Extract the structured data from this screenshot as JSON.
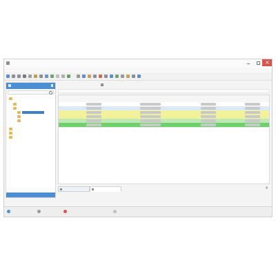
{
  "window": {
    "title": "",
    "controls": {
      "minimize": "",
      "maximize": "",
      "close": ""
    }
  },
  "menu": [
    {
      "label": ""
    },
    {
      "label": ""
    },
    {
      "label": ""
    },
    {
      "label": ""
    },
    {
      "label": ""
    },
    {
      "label": ""
    },
    {
      "label": ""
    }
  ],
  "toolbar": [
    {
      "icon": "save-icon",
      "color": "#5a8fd1"
    },
    {
      "icon": "undo-icon",
      "color": "#8a8f99"
    },
    {
      "icon": "redo-icon",
      "color": "#8a8f99"
    },
    {
      "icon": "print-icon",
      "color": "#7a7a7a"
    },
    {
      "icon": "copy-icon",
      "color": "#a0a0a0"
    },
    {
      "icon": "paste-icon",
      "color": "#c2a04a"
    },
    {
      "icon": "cut-icon",
      "color": "#8a8f99"
    },
    {
      "icon": "find-icon",
      "color": "#6e93c9"
    },
    {
      "icon": "refresh-icon",
      "color": "#6aa96e"
    },
    {
      "icon": "filter-icon",
      "color": "#c0c0c0"
    },
    {
      "icon": "sort-icon",
      "color": "#b0b0b0"
    },
    {
      "icon": "export-icon",
      "color": "#5fa863"
    },
    {
      "icon": "settings-icon",
      "color": "#999999"
    },
    {
      "icon": "help-icon",
      "color": "#5a8fd1"
    },
    {
      "icon": "tool-icon",
      "color": "#c9a24f"
    },
    {
      "icon": "tool-icon",
      "color": "#8a8f99"
    },
    {
      "icon": "tool-icon",
      "color": "#d26a4a"
    },
    {
      "icon": "tool-icon",
      "color": "#8a8f99"
    },
    {
      "icon": "tool-icon",
      "color": "#5a8fd1"
    },
    {
      "icon": "tool-icon",
      "color": "#6aa96e"
    },
    {
      "icon": "tool-icon",
      "color": "#999999"
    },
    {
      "icon": "tool-icon",
      "color": "#c9a24f"
    },
    {
      "icon": "tool-icon",
      "color": "#8a8f99"
    },
    {
      "icon": "tool-icon",
      "color": "#5a8fd1"
    }
  ],
  "nav": {
    "header": "",
    "header_color": "#4a8fd6",
    "search_placeholder": "",
    "tree": [
      {
        "label": "",
        "level": 0,
        "selected": false
      },
      {
        "label": "",
        "level": 1,
        "selected": false
      },
      {
        "label": "",
        "level": 1,
        "selected": false
      },
      {
        "label": "",
        "level": 2,
        "selected": true
      },
      {
        "label": "",
        "level": 2,
        "selected": false
      },
      {
        "label": "",
        "level": 2,
        "selected": false
      },
      {
        "label": "",
        "level": 0,
        "selected": false
      },
      {
        "label": "",
        "level": 0,
        "selected": false
      },
      {
        "label": "",
        "level": 0,
        "selected": false
      }
    ],
    "bottom_label": ""
  },
  "content": {
    "actions": [
      {
        "label": ""
      },
      {
        "label": ""
      }
    ],
    "columns": [
      "",
      "",
      "",
      "",
      "",
      "",
      "",
      ""
    ],
    "rows": [
      {
        "bg": "#ffffff",
        "cells": [
          "",
          "",
          "",
          "",
          "",
          "",
          "",
          ""
        ]
      },
      {
        "bg": "#dbeaf7",
        "cells": [
          "",
          "",
          "",
          "",
          "",
          "",
          "",
          ""
        ]
      },
      {
        "bg": "#f2f29a",
        "cells": [
          "",
          "",
          "",
          "",
          "",
          "",
          "",
          ""
        ]
      },
      {
        "bg": "#f2f29a",
        "cells": [
          "",
          "",
          "",
          "",
          "",
          "",
          "",
          ""
        ]
      },
      {
        "bg": "#bfe8b4",
        "cells": [
          "",
          "",
          "",
          "",
          "",
          "",
          "",
          ""
        ]
      },
      {
        "bg": "#6fd06b",
        "cells": [
          "",
          "",
          "",
          "",
          "",
          "",
          "",
          ""
        ]
      }
    ],
    "tabs": [
      {
        "label": "",
        "active": false
      },
      {
        "label": "",
        "active": true
      }
    ],
    "tab_note": ""
  },
  "status": [
    {
      "label": ""
    },
    {
      "label": ""
    },
    {
      "label": ""
    },
    {
      "label": ""
    },
    {
      "label": ""
    }
  ]
}
